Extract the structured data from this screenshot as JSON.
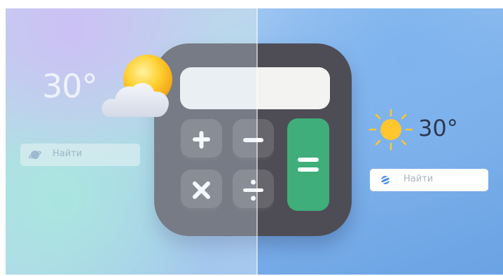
{
  "colors": {
    "calculator_body": "#4e4d55",
    "calculator_key": "#67666d",
    "equals_key": "#3fae7b",
    "sun": "#ffc62e",
    "planet_icon": "#4b8fe6"
  },
  "left_panel": {
    "temperature": "30°",
    "weather_icon": "sun-behind-cloud-icon",
    "search": {
      "placeholder": "Найти",
      "icon": "planet-icon"
    }
  },
  "right_panel": {
    "temperature": "30°",
    "weather_icon": "sun-icon",
    "search": {
      "placeholder": "Найти",
      "icon": "planet-icon"
    }
  },
  "calculator": {
    "icon": "calculator-icon",
    "keys": [
      {
        "name": "plus-icon"
      },
      {
        "name": "minus-icon"
      },
      {
        "name": "multiply-icon"
      },
      {
        "name": "divide-icon"
      },
      {
        "name": "equals-icon"
      }
    ]
  }
}
